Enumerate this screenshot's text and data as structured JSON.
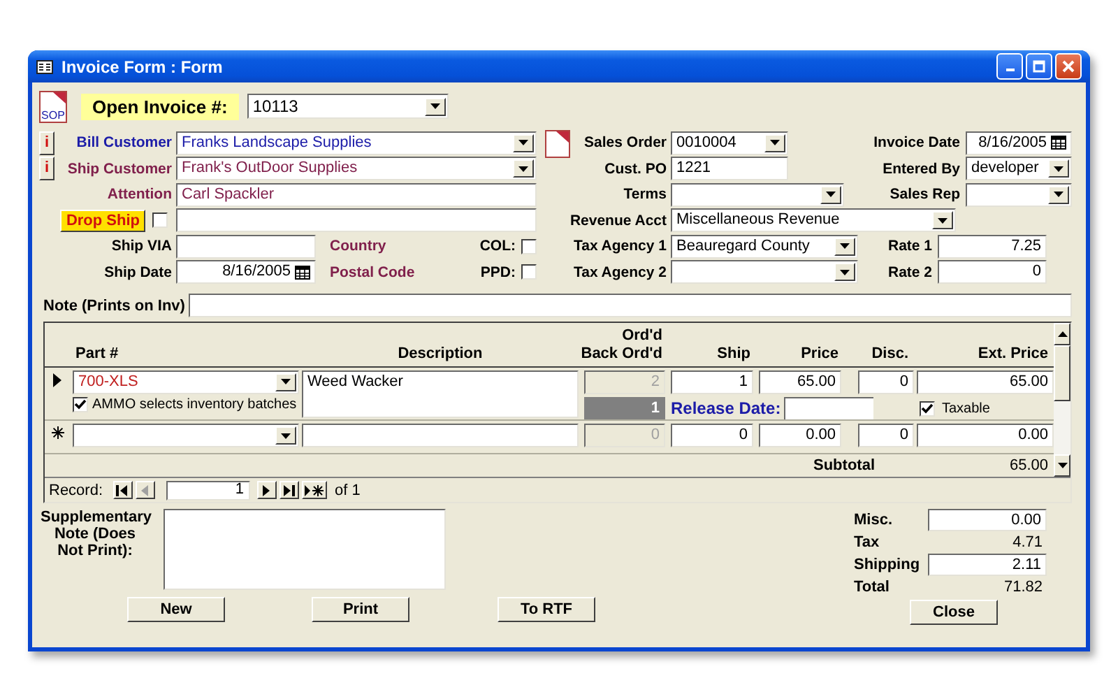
{
  "window": {
    "title": "Invoice Form : Form"
  },
  "invoice_selector": {
    "icon_text": "SOP",
    "label": "Open Invoice #:",
    "value": "10113"
  },
  "customer_fields": [
    {
      "kind": "combo",
      "info_button": "i",
      "label": "Bill Customer",
      "value": "Franks Landscape Supplies",
      "color": "#1c1ca8"
    },
    {
      "kind": "combo",
      "info_button": "i",
      "label": "Ship Customer",
      "value": "Frank's OutDoor Supplies",
      "color": "#80204c"
    },
    {
      "kind": "text",
      "label": "Attention",
      "value": "Carl Spackler",
      "color": "#80204c"
    }
  ],
  "drop_ship": {
    "label": "Drop Ship",
    "checked": false
  },
  "shipping": [
    {
      "kind": "text",
      "label": "Ship VIA",
      "extra_label": "Country",
      "option": {
        "label": "COL:",
        "checked": false
      }
    },
    {
      "kind": "date",
      "label": "Ship Date",
      "value": "8/16/2005",
      "extra_label": "Postal Code",
      "option": {
        "label": "PPD:",
        "checked": false
      }
    }
  ],
  "order_fields": [
    {
      "kind": "combo",
      "label": "Sales Order",
      "value": "0010004"
    },
    {
      "kind": "text",
      "label": "Cust. PO",
      "value": "1221"
    },
    {
      "kind": "combo",
      "label": "Terms"
    },
    {
      "kind": "combo",
      "label": "Revenue Acct",
      "value": "Miscellaneous Revenue"
    },
    {
      "kind": "combo",
      "label": "Tax Agency 1",
      "value": "Beauregard County"
    },
    {
      "kind": "combo",
      "label": "Tax Agency 2"
    }
  ],
  "invoice_fields": [
    {
      "kind": "date",
      "label": "Invoice Date",
      "value": "8/16/2005"
    },
    {
      "kind": "combo",
      "label": "Entered By",
      "value": "developer"
    },
    {
      "kind": "combo",
      "label": "Sales Rep"
    }
  ],
  "rates": [
    {
      "label": "Rate 1",
      "value": "7.25"
    },
    {
      "label": "Rate 2",
      "value": "0"
    }
  ],
  "note": {
    "label": "Note (Prints on Inv)"
  },
  "lines": {
    "columns": [
      {
        "label": "Part #"
      },
      {
        "label": "Description"
      },
      {
        "label": "Back Ord'd",
        "over": "Ord'd"
      },
      {
        "label": "Ship"
      },
      {
        "label": "Price"
      },
      {
        "label": "Disc."
      },
      {
        "label": "Ext. Price"
      }
    ],
    "rows": [
      {
        "kind": "current",
        "part": "700-XLS",
        "description": "Weed Wacker",
        "ordered": "2",
        "ship": "1",
        "price": "65.00",
        "disc": "0",
        "ext_price": "65.00",
        "ammo": {
          "label": "AMMO selects inventory batches",
          "checked": true
        },
        "back_ordered": "1",
        "release_label": "Release Date:",
        "taxable": {
          "label": "Taxable",
          "checked": true
        }
      },
      {
        "kind": "new",
        "ordered": "0",
        "ship": "0",
        "price": "0.00",
        "disc": "0",
        "ext_price": "0.00"
      }
    ],
    "subtotal": {
      "label": "Subtotal",
      "value": "65.00"
    }
  },
  "navigator": {
    "label": "Record:",
    "value": "1",
    "count": "of 1"
  },
  "supplementary_note": {
    "label": "Supplementary Note (Does Not Print):"
  },
  "totals": [
    {
      "kind": "field",
      "label": "Misc.",
      "value": "0.00"
    },
    {
      "kind": "text",
      "label": "Tax",
      "value": "4.71"
    },
    {
      "kind": "field",
      "label": "Shipping",
      "value": "2.11"
    },
    {
      "kind": "text",
      "label": "Total",
      "value": "71.82"
    }
  ],
  "buttons": [
    {
      "label": "New"
    },
    {
      "label": "Print"
    },
    {
      "label": "To RTF"
    },
    {
      "label": "Close"
    }
  ]
}
